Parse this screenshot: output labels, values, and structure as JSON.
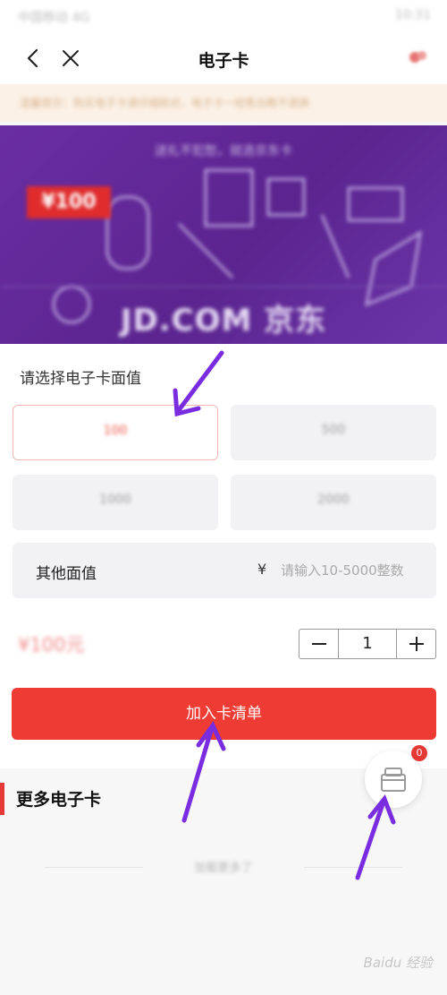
{
  "status_bar": {
    "left_text": "中国移动 4G",
    "right_text": "10:31"
  },
  "header": {
    "title": "电子卡",
    "back_icon": "chevron-left-icon",
    "close_icon": "close-icon",
    "cart_icon": "cart-icon"
  },
  "notice": {
    "text": "温馨提示：购买电子卡请仔细核对，电子卡一经售出概不退换"
  },
  "banner": {
    "slogan": "送礼不犯愁，就选京东卡",
    "badge": "¥100",
    "brand": "JD.COM 京东"
  },
  "denomination": {
    "label": "请选择电子卡面值",
    "options": [
      {
        "label": "100",
        "selected": true
      },
      {
        "label": "500",
        "selected": false
      },
      {
        "label": "1000",
        "selected": false
      },
      {
        "label": "2000",
        "selected": false
      }
    ],
    "other_label": "其他面值",
    "currency_symbol": "¥",
    "other_placeholder": "请输入10-5000整数"
  },
  "order": {
    "price": "¥100元",
    "quantity": "1",
    "minus_label": "−",
    "plus_label": "+",
    "add_button_label": "加入卡清单"
  },
  "more": {
    "title": "更多电子卡",
    "loading_text": "加载更多了"
  },
  "float_cart": {
    "icon": "card-list-icon",
    "badge_count": "0"
  },
  "watermark": "Baidu 经验",
  "colors": {
    "accent": "#ee3b33",
    "annotation_arrow": "#7a2de0",
    "banner": "#5b248f"
  }
}
